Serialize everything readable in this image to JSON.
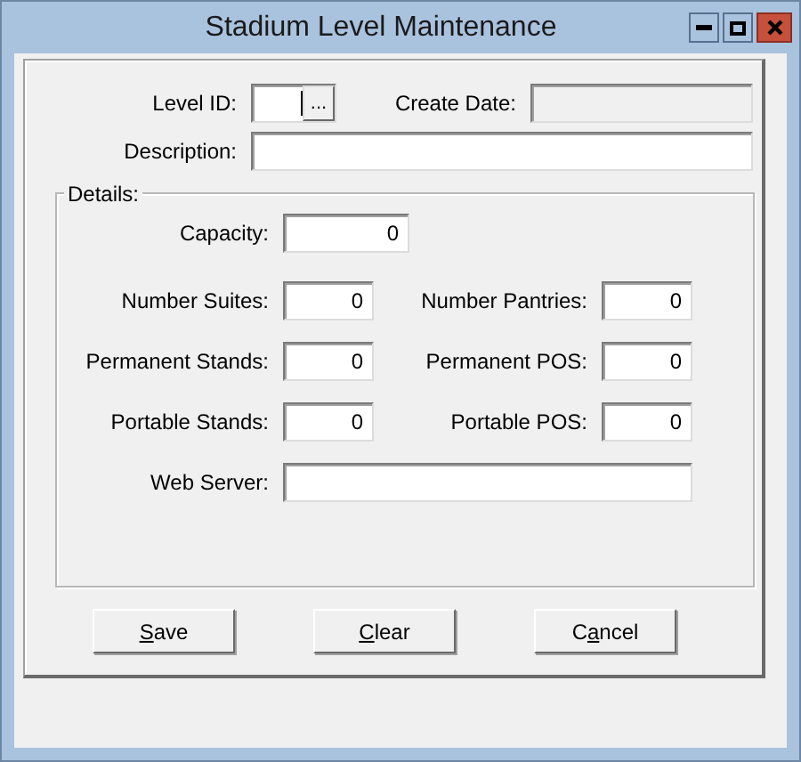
{
  "window": {
    "title": "Stadium Level Maintenance"
  },
  "header_rows": [
    [
      {
        "label": "Level ID:",
        "kind": "lookup",
        "browse_label": "...",
        "focused": true,
        "disabled": false
      },
      {
        "label": "Create Date:",
        "kind": "text",
        "focused": false,
        "disabled": true
      }
    ],
    [
      {
        "label": "Description:",
        "kind": "text",
        "focused": false,
        "disabled": false
      }
    ]
  ],
  "details": {
    "title": "Details:",
    "rows": [
      [
        {
          "label": "Capacity:",
          "kind": "number",
          "value": "0"
        }
      ],
      [
        {
          "label": "Number Suites:",
          "kind": "number",
          "value": "0"
        },
        {
          "label": "Number Pantries:",
          "kind": "number",
          "value": "0"
        }
      ],
      [
        {
          "label": "Permanent Stands:",
          "kind": "number",
          "value": "0"
        },
        {
          "label": "Permanent POS:",
          "kind": "number",
          "value": "0"
        }
      ],
      [
        {
          "label": "Portable Stands:",
          "kind": "number",
          "value": "0"
        },
        {
          "label": "Portable POS:",
          "kind": "number",
          "value": "0"
        }
      ],
      [
        {
          "label": "Web Server:",
          "kind": "text"
        }
      ]
    ]
  },
  "buttons": [
    {
      "underlined": "S",
      "after": "ave"
    },
    {
      "underlined": "C",
      "after": "lear"
    },
    {
      "before": "C",
      "underlined": "a",
      "after": "ncel"
    }
  ]
}
